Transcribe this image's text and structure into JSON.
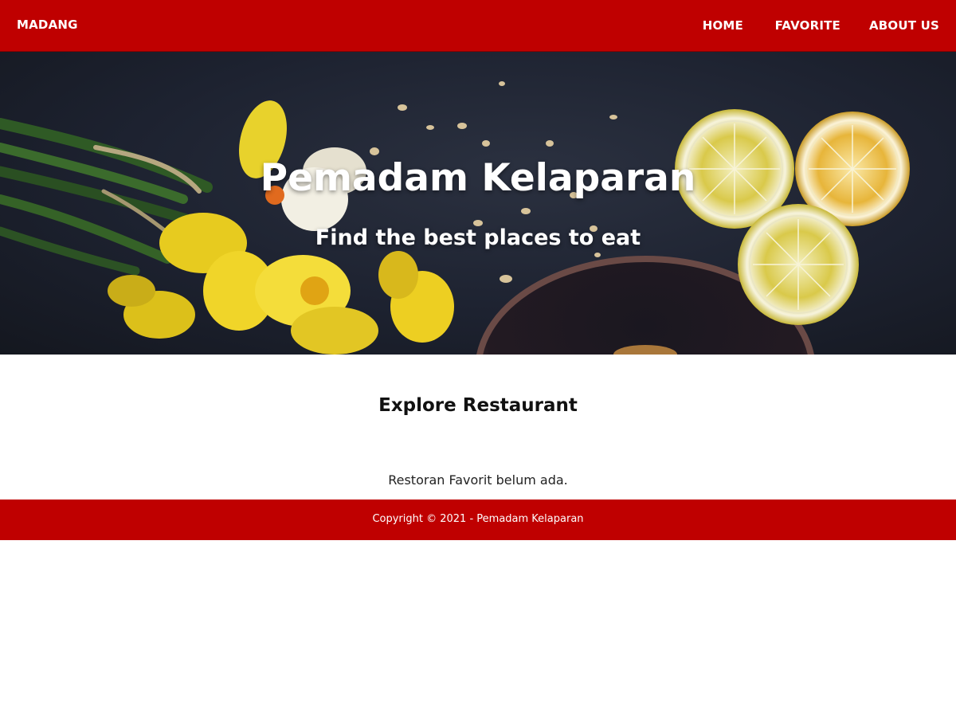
{
  "navbar": {
    "brand": "MADANG",
    "items": [
      {
        "label": "HOME"
      },
      {
        "label": "FAVORITE"
      },
      {
        "label": "ABOUT US"
      }
    ],
    "color": "#bf0000"
  },
  "hero": {
    "title": "Pemadam Kelaparan",
    "subtitle": "Find the best places to eat",
    "background_image": "food-flowers-lemons-photo"
  },
  "main": {
    "section_title": "Explore Restaurant",
    "empty_message": "Restoran Favorit belum ada."
  },
  "footer": {
    "copyright": "Copyright © 2021 - Pemadam Kelaparan",
    "color": "#bf0000"
  }
}
